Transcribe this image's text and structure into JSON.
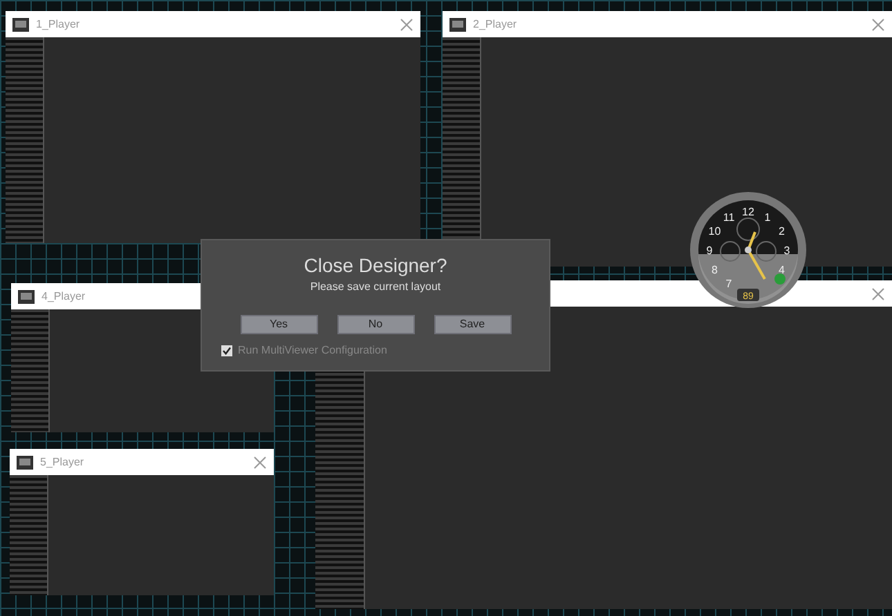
{
  "windows": [
    {
      "kind": "titled",
      "title": "1_Player"
    },
    {
      "kind": "titled",
      "title": "2_Player"
    },
    {
      "kind": "covered"
    },
    {
      "kind": "titled",
      "title": "4_Player"
    },
    {
      "kind": "titled",
      "title": "5_Player"
    }
  ],
  "clock": {
    "numerals": [
      "11",
      "12",
      "1",
      "10",
      "2",
      "9",
      "3",
      "8",
      "4",
      "7"
    ],
    "counter": "89"
  },
  "dialog": {
    "title": "Close Designer?",
    "message": "Please save current layout",
    "buttons": [
      "Yes",
      "No",
      "Save"
    ],
    "checkbox": {
      "label": "Run MultiViewer Configuration",
      "checked": true
    }
  }
}
